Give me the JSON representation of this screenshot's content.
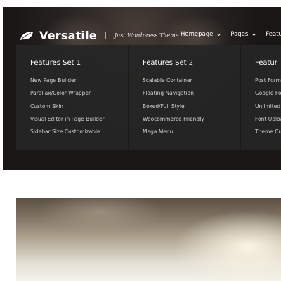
{
  "header": {
    "brand_name": "Versatile",
    "tagline": "Just Wordpress Theme",
    "logo_icon": "leaf-icon"
  },
  "nav": {
    "items": [
      {
        "label": "Homepage",
        "has_dropdown": true
      },
      {
        "label": "Pages",
        "has_dropdown": true
      },
      {
        "label": "Featu",
        "has_dropdown": false
      }
    ]
  },
  "mega_menu": {
    "columns": [
      {
        "title": "Features Set 1",
        "items": [
          "New Page Builder",
          "Parallax/Color Wrapper",
          "Custom Skin",
          "Visual Editor in Page Builder",
          "Sidebar Size Customizable"
        ]
      },
      {
        "title": "Features Set 2",
        "items": [
          "Scalable Container",
          "Floating Navigation",
          "Boxed/Full Style",
          "Woocommerce Friendly",
          "Mega Menu"
        ]
      },
      {
        "title": "Featur",
        "items": [
          "Post Forma",
          "Google Fo",
          "Unlimited",
          "Font Uploa",
          "Theme Cu"
        ]
      }
    ]
  },
  "colors": {
    "menu_bg": "#262626",
    "text": "#ffffff",
    "menu_item": "#d2d2d2"
  }
}
